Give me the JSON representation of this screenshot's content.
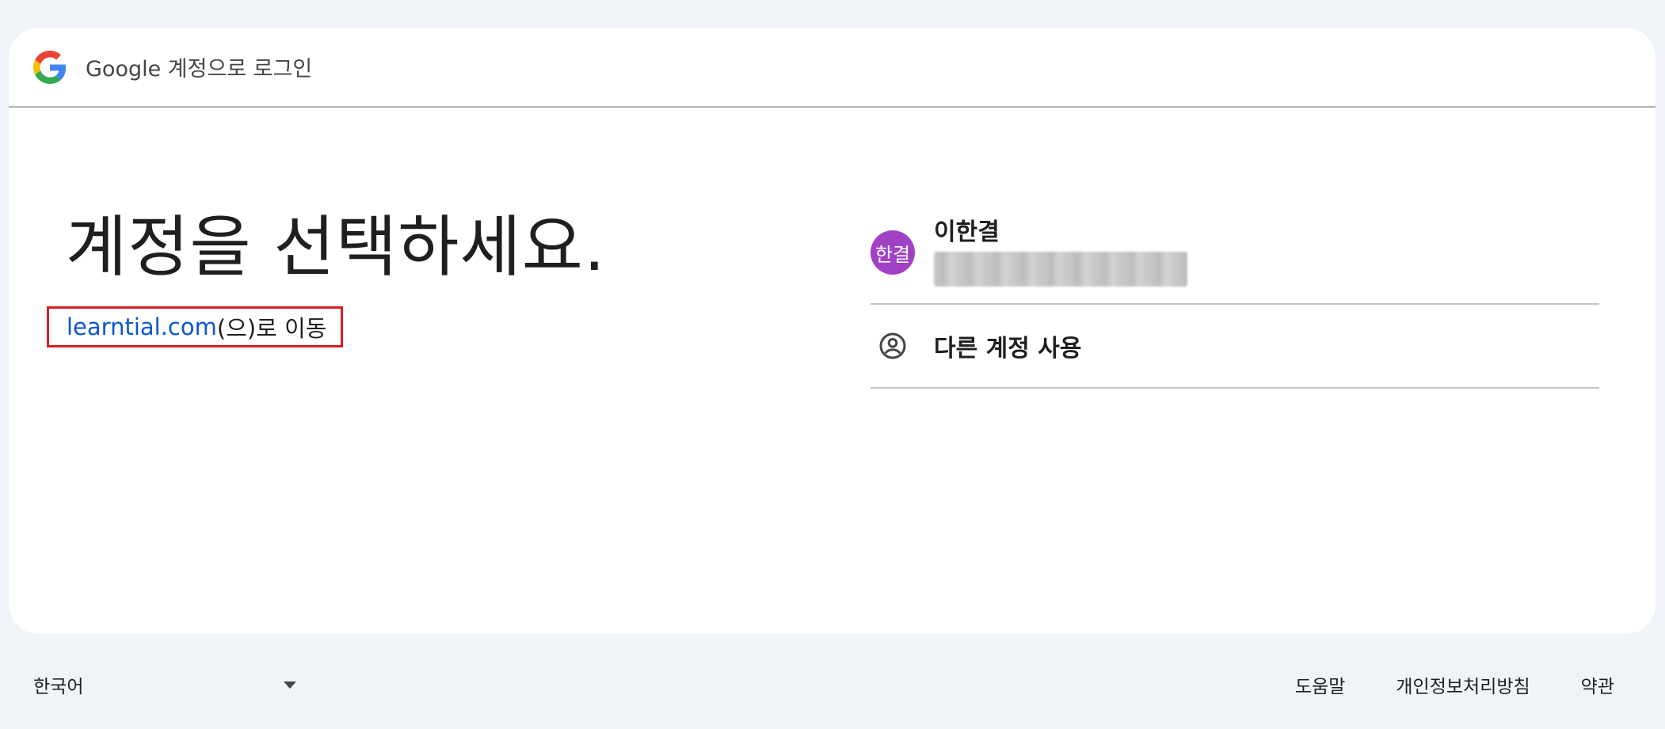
{
  "header": {
    "logo_icon": "google-g-icon",
    "title": "Google 계정으로 로그인"
  },
  "main": {
    "headline": "계정을 선택하세요.",
    "continue_to": {
      "link": "learntial.com",
      "suffix": "(으)로 이동"
    }
  },
  "accounts": [
    {
      "avatar_initials": "한결",
      "avatar_color": "#a142c6",
      "name": "이한결"
    }
  ],
  "other_account": {
    "icon": "account-circle-icon",
    "label": "다른 계정 사용"
  },
  "footer": {
    "language": "한국어",
    "links": [
      "도움말",
      "개인정보처리방침",
      "약관"
    ]
  },
  "colors": {
    "link": "#0b57d0",
    "highlight_border": "#d81e1e",
    "page_background": "#f0f4f9"
  }
}
